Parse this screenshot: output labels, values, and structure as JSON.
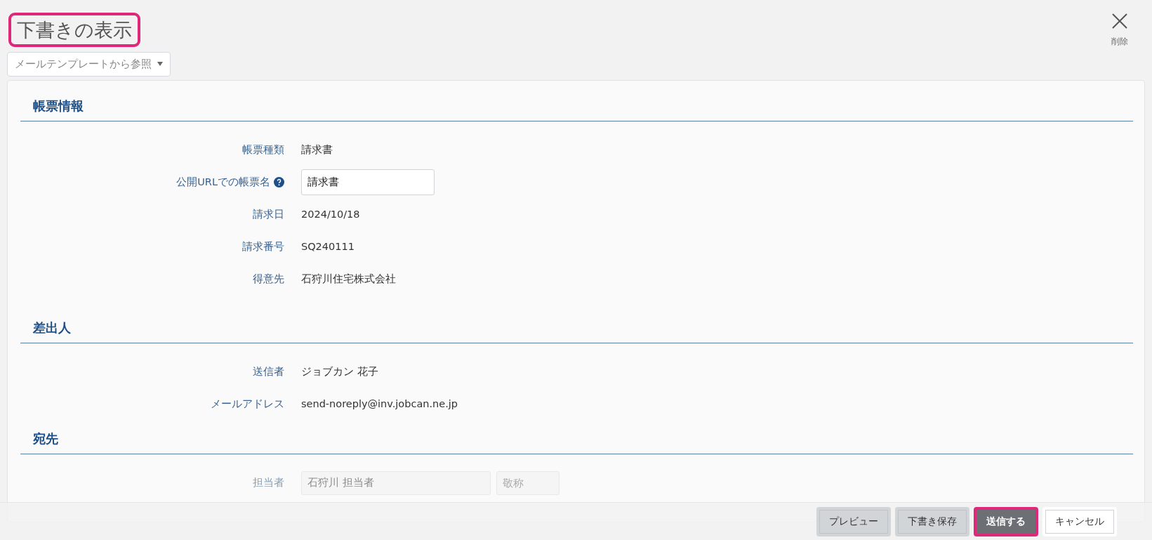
{
  "title": {
    "text": "下書きの表示",
    "highlighted": true
  },
  "delete": {
    "label": "削除"
  },
  "template_dropdown": {
    "label": "メールテンプレートから参照"
  },
  "sections": [
    {
      "heading": "帳票情報",
      "rows": [
        {
          "kind": "text",
          "label": "帳票種類",
          "value": "請求書"
        },
        {
          "kind": "input",
          "label": "公開URLでの帳票名",
          "help": true,
          "value": "請求書"
        },
        {
          "kind": "text",
          "label": "請求日",
          "value": "2024/10/18"
        },
        {
          "kind": "text",
          "label": "請求番号",
          "value": "SQ240111"
        },
        {
          "kind": "text",
          "label": "得意先",
          "value": "石狩川住宅株式会社"
        }
      ]
    },
    {
      "heading": "差出人",
      "rows": [
        {
          "kind": "text",
          "label": "送信者",
          "value": "ジョブカン 花子"
        },
        {
          "kind": "text",
          "label": "メールアドレス",
          "value": "send-noreply@inv.jobcan.ne.jp"
        }
      ]
    },
    {
      "heading": "宛先",
      "rows": [
        {
          "kind": "name_input",
          "label": "担当者",
          "value": "石狩川 担当者",
          "placeholder": "敬称"
        }
      ]
    }
  ],
  "buttons": [
    {
      "label": "プレビュー",
      "kind": "secondary",
      "highlighted": false
    },
    {
      "label": "下書き保存",
      "kind": "secondary",
      "highlighted": false
    },
    {
      "label": "送信する",
      "kind": "primary",
      "highlighted": true
    },
    {
      "label": "キャンセル",
      "kind": "outline",
      "highlighted": false
    }
  ]
}
